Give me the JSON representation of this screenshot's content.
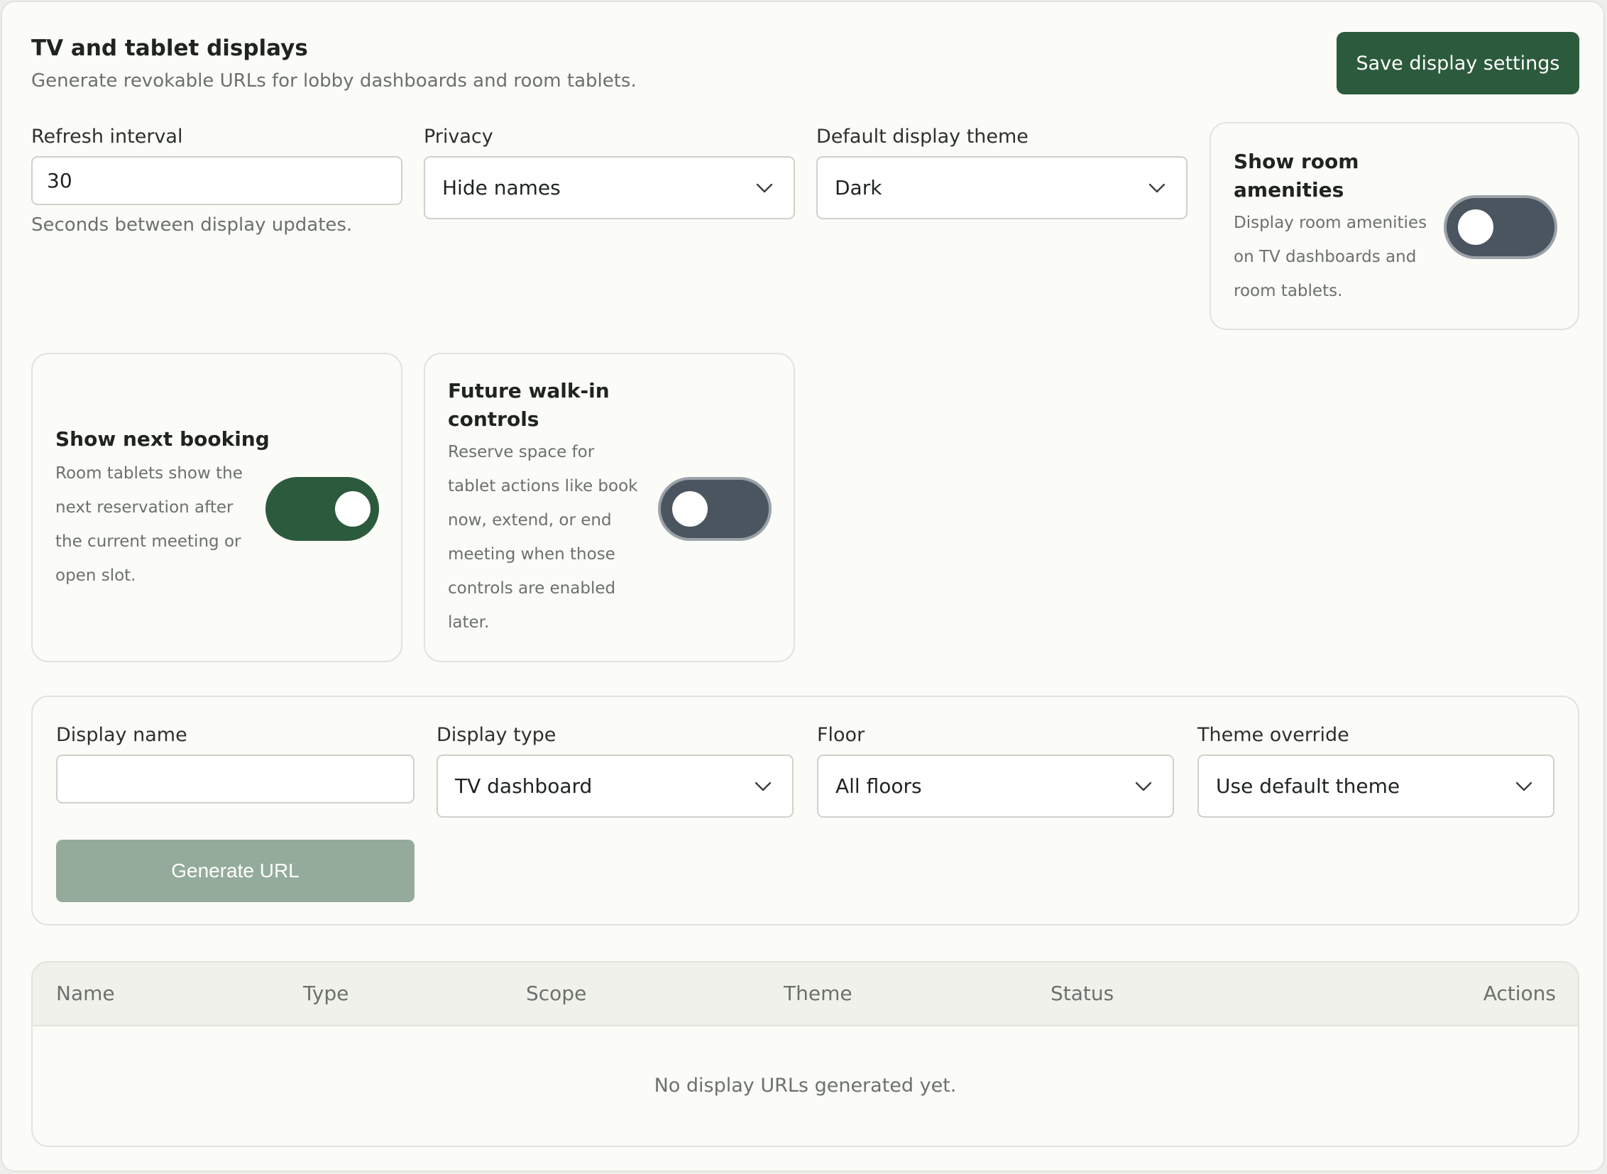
{
  "header": {
    "title": "TV and tablet displays",
    "subtitle": "Generate revokable URLs for lobby dashboards and room tablets.",
    "save_label": "Save display settings"
  },
  "settings": {
    "refresh": {
      "label": "Refresh interval",
      "value": "30",
      "hint": "Seconds between display updates."
    },
    "privacy": {
      "label": "Privacy",
      "value": "Hide names"
    },
    "theme": {
      "label": "Default display theme",
      "value": "Dark"
    },
    "amenities": {
      "title_line1": "Show room",
      "title_line2": "amenities",
      "desc_lines": [
        "Display room amenities",
        "on TV dashboards and",
        "room tablets."
      ],
      "enabled": false
    },
    "next_booking": {
      "title": "Show next booking",
      "desc_lines": [
        "Room tablets show the",
        "next reservation after",
        "the current meeting or",
        "open slot."
      ],
      "enabled": true
    },
    "walk_in": {
      "title_line1": "Future walk-in",
      "title_line2": "controls",
      "desc_lines": [
        "Reserve space for",
        "tablet actions like book",
        "now, extend, or end",
        "meeting when those",
        "controls are enabled",
        "later."
      ],
      "enabled": false
    }
  },
  "generator": {
    "display_name": {
      "label": "Display name",
      "value": ""
    },
    "display_type": {
      "label": "Display type",
      "value": "TV dashboard"
    },
    "floor": {
      "label": "Floor",
      "value": "All floors"
    },
    "theme_override": {
      "label": "Theme override",
      "value": "Use default theme"
    },
    "generate_label": "Generate URL"
  },
  "table": {
    "columns": [
      "Name",
      "Type",
      "Scope",
      "Theme",
      "Status",
      "Actions"
    ],
    "empty_text": "No display URLs generated yet."
  },
  "colors": {
    "accent": "#2c5a3c",
    "accent_disabled": "#94ab9b",
    "toggle_off": "#4a5560",
    "background": "#fbfbf8"
  },
  "icons": {
    "select_chevron": "chevron-down-icon"
  }
}
